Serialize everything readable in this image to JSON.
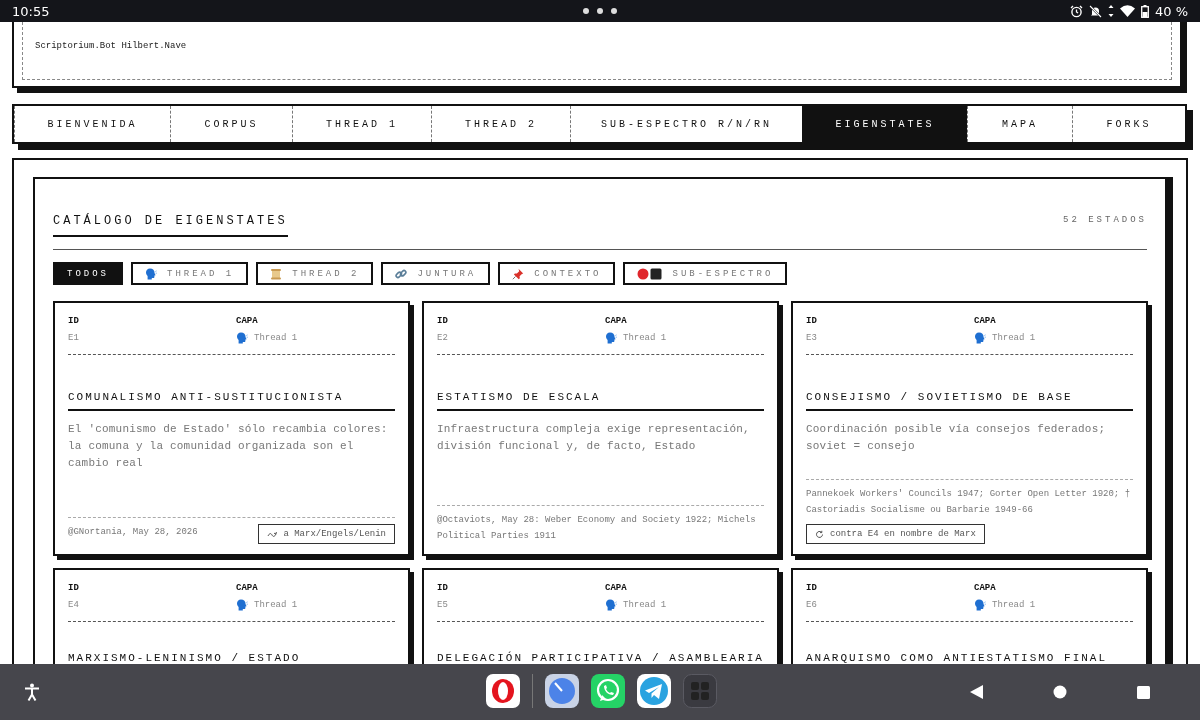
{
  "status_bar": {
    "time": "10:55",
    "battery": "40 %"
  },
  "top_card": {
    "text": "Scriptorium.Bot Hilbert.Nave"
  },
  "tabs": [
    {
      "label": "BIENVENIDA",
      "selected": false
    },
    {
      "label": "CORPUS",
      "selected": false
    },
    {
      "label": "THREAD 1",
      "selected": false
    },
    {
      "label": "THREAD 2",
      "selected": false
    },
    {
      "label": "SUB-ESPECTRO R/N/RN",
      "selected": false
    },
    {
      "label": "EIGENSTATES",
      "selected": true
    },
    {
      "label": "MAPA",
      "selected": false
    },
    {
      "label": "FORKS",
      "selected": false
    }
  ],
  "catalog": {
    "title": "CATÁLOGO DE EIGENSTATES",
    "count": "52 ESTADOS",
    "filters": [
      {
        "label": "TODOS",
        "kind": "all",
        "selected": true
      },
      {
        "label": "THREAD 1",
        "kind": "speech",
        "selected": false
      },
      {
        "label": "THREAD 2",
        "kind": "scroll",
        "selected": false
      },
      {
        "label": "JUNTURA",
        "kind": "link",
        "selected": false
      },
      {
        "label": "CONTEXTO",
        "kind": "pin",
        "selected": false
      },
      {
        "label": "SUB-ESPECTRO",
        "kind": "spectrum",
        "selected": false
      }
    ],
    "cards": [
      {
        "id_label": "ID",
        "layer_label": "CAPA",
        "id": "E1",
        "layer": "Thread 1",
        "kind": "speech",
        "title": "COMUNALISMO ANTI-SUSTITUCIONISTA",
        "description": "El 'comunismo de Estado' sólo recambia colores: la comuna y la comunidad organizada son el cambio real",
        "source": "@GNortania, May 28, 2026",
        "tag": {
          "label": "a Marx/Engels/Lenin",
          "kind": "derives"
        }
      },
      {
        "id_label": "ID",
        "layer_label": "CAPA",
        "id": "E2",
        "layer": "Thread 1",
        "kind": "speech",
        "title": "ESTATISMO DE ESCALA",
        "description": "Infraestructura compleja exige representación, división funcional y, de facto, Estado",
        "source": "@Octaviots, May 28: Weber Economy and Society 1922; Michels Political Parties 1911"
      },
      {
        "id_label": "ID",
        "layer_label": "CAPA",
        "id": "E3",
        "layer": "Thread 1",
        "kind": "speech",
        "title": "CONSEJISMO / SOVIETISMO DE BASE",
        "description": "Coordinación posible vía consejos federados; soviet = consejo",
        "source": "Pannekoek Workers' Councils 1947; Gorter Open Letter 1920; † Castoriadis Socialisme ou Barbarie 1949-66",
        "tag": {
          "label": "contra E4 en nombre de Marx",
          "kind": "against"
        }
      },
      {
        "id_label": "ID",
        "layer_label": "CAPA",
        "id": "E4",
        "layer": "Thread 1",
        "kind": "speech",
        "title": "MARXISMO-LENINISMO / ESTADO"
      },
      {
        "id_label": "ID",
        "layer_label": "CAPA",
        "id": "E5",
        "layer": "Thread 1",
        "kind": "speech",
        "title": "DELEGACIÓN PARTICIPATIVA / ASAMBLEARIA"
      },
      {
        "id_label": "ID",
        "layer_label": "CAPA",
        "id": "E6",
        "layer": "Thread 1",
        "kind": "speech",
        "title": "ANARQUISMO COMO ANTIESTATISMO FINAL"
      }
    ]
  }
}
